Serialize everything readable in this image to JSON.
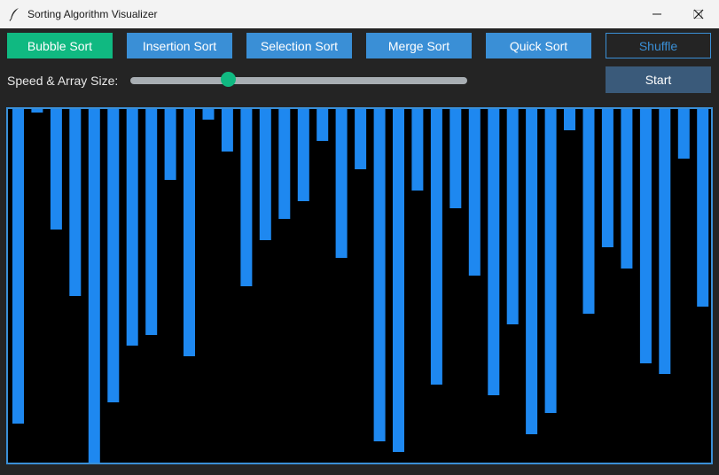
{
  "window": {
    "title": "Sorting Algorithm Visualizer"
  },
  "buttons": {
    "bubble": "Bubble Sort",
    "insertion": "Insertion Sort",
    "selection": "Selection Sort",
    "merge": "Merge Sort",
    "quick": "Quick Sort",
    "shuffle": "Shuffle",
    "start": "Start"
  },
  "controls": {
    "speed_label": "Speed & Array Size:",
    "slider_value": 0.29
  },
  "colors": {
    "bar": "#1e88f0",
    "accent": "#10b981",
    "button": "#3a8fd6",
    "start_button": "#3a5a7a",
    "canvas_bg": "#000000"
  },
  "icons": {
    "app": "feather-icon",
    "minimize": "minimize-icon",
    "maximize": "maximize-icon",
    "close": "close-icon"
  },
  "array": {
    "values": [
      89,
      1,
      34,
      53,
      100,
      83,
      67,
      64,
      20,
      70,
      3,
      12,
      50,
      37,
      31,
      26,
      9,
      42,
      17,
      94,
      97,
      23,
      78,
      28,
      47,
      81,
      61,
      92,
      86,
      6,
      58,
      39,
      45,
      72,
      75,
      14,
      56
    ]
  }
}
